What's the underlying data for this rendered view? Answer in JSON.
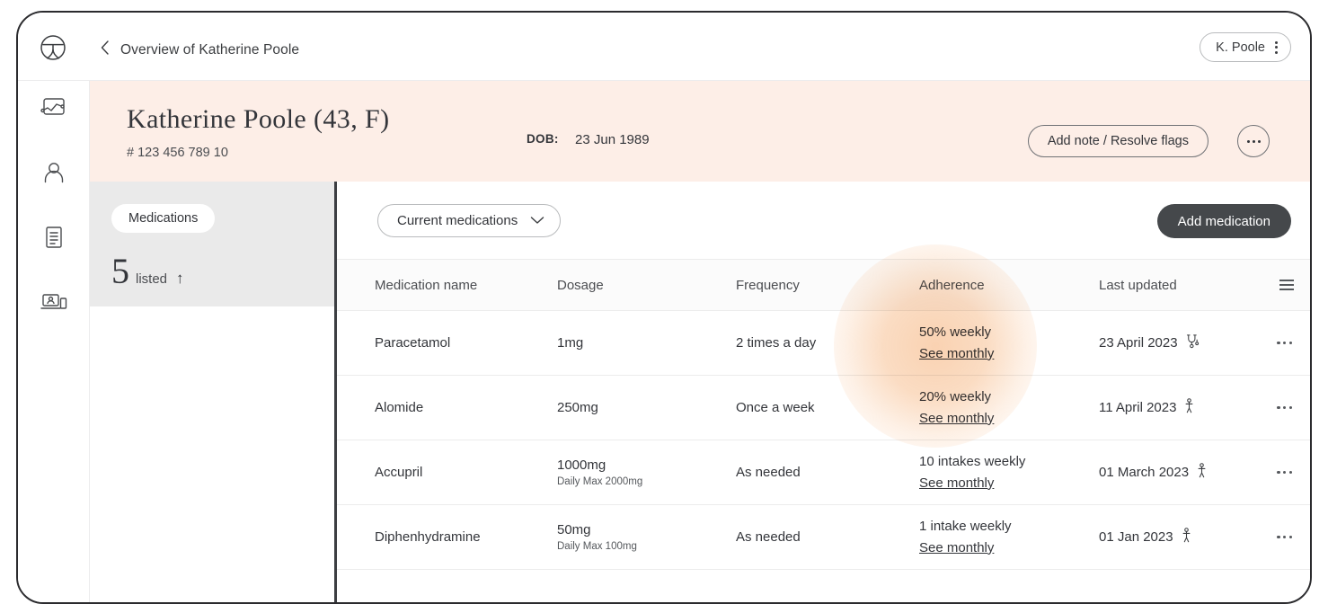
{
  "topbar": {
    "logo_icon": "clinic-logo-icon",
    "back_icon": "chevron-left-icon",
    "breadcrumb": "Overview of Katherine Poole",
    "profile_name": "K. Poole",
    "profile_menu_icon": "vertical-dots-icon"
  },
  "sidebar": {
    "items": [
      {
        "icon": "analytics-chart-icon",
        "name": "sidebar-item-analytics"
      },
      {
        "icon": "person-icon",
        "name": "sidebar-item-patient"
      },
      {
        "icon": "document-icon",
        "name": "sidebar-item-records"
      },
      {
        "icon": "telehealth-devices-icon",
        "name": "sidebar-item-telehealth"
      }
    ]
  },
  "patient": {
    "name_line": "Katherine Poole (43,  F)",
    "id_line": "# 123 456 789 10",
    "dob_label": "DOB:",
    "dob_value": "23 Jun 1989",
    "add_note_label": "Add note / Resolve flags",
    "more_icon": "horizontal-dots-icon",
    "banner_color": "#fdeee7"
  },
  "summary": {
    "chip_label": "Medications",
    "count": "5",
    "count_label": "listed",
    "trend_icon": "arrow-up-icon",
    "trend_glyph": "↑",
    "panel_color": "#eaeaea"
  },
  "toolbar": {
    "filter_label": "Current medications",
    "filter_caret_icon": "chevron-down-icon",
    "add_medication_label": "Add medication",
    "add_medication_color": "#45484b"
  },
  "table": {
    "columns": [
      "Medication name",
      "Dosage",
      "Frequency",
      "Adherence",
      "Last updated"
    ],
    "options_icon": "hamburger-menu-icon",
    "rows": [
      {
        "name": "Paracetamol",
        "dosage": "1mg",
        "dosage_sub": "",
        "frequency": "2 times a day",
        "adherence": "50% weekly",
        "adherence_link": "See monthly",
        "last_updated": "23 April 2023",
        "updated_by_icon": "stethoscope-icon",
        "row_menu_icon": "horizontal-dots-icon"
      },
      {
        "name": "Alomide",
        "dosage": "250mg",
        "dosage_sub": "",
        "frequency": "Once a week",
        "adherence": "20% weekly",
        "adherence_link": "See monthly",
        "last_updated": "11 April 2023",
        "updated_by_icon": "person-standing-icon",
        "row_menu_icon": "horizontal-dots-icon"
      },
      {
        "name": "Accupril",
        "dosage": "1000mg",
        "dosage_sub": "Daily Max 2000mg",
        "frequency": "As needed",
        "adherence": "10 intakes weekly",
        "adherence_link": "See monthly",
        "last_updated": "01 March 2023",
        "updated_by_icon": "person-standing-icon",
        "row_menu_icon": "horizontal-dots-icon"
      },
      {
        "name": "Diphenhydramine",
        "dosage": "50mg",
        "dosage_sub": "Daily Max 100mg",
        "frequency": "As needed",
        "adherence": "1 intake weekly",
        "adherence_link": "See monthly",
        "last_updated": "01 Jan 2023",
        "updated_by_icon": "person-standing-icon",
        "row_menu_icon": "horizontal-dots-icon"
      }
    ]
  },
  "highlight": {
    "name": "adherence-column-spotlight",
    "color": "#f9ceab"
  }
}
